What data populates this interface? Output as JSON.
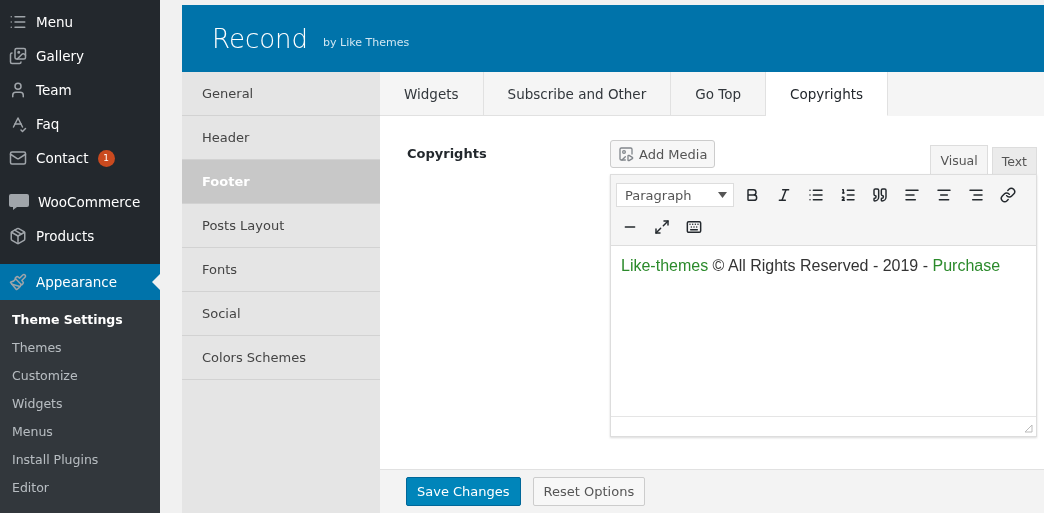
{
  "sidebar": {
    "items": [
      {
        "label": "Menu",
        "selected": false
      },
      {
        "label": "Gallery",
        "selected": false
      },
      {
        "label": "Team",
        "selected": false
      },
      {
        "label": "Faq",
        "selected": false
      },
      {
        "label": "Contact",
        "selected": false,
        "badge": "1"
      },
      {
        "label": "WooCommerce",
        "selected": false
      },
      {
        "label": "Products",
        "selected": false
      },
      {
        "label": "Appearance",
        "selected": true
      }
    ],
    "submenu": [
      {
        "label": "Theme Settings",
        "selected": true
      },
      {
        "label": "Themes",
        "selected": false
      },
      {
        "label": "Customize",
        "selected": false
      },
      {
        "label": "Widgets",
        "selected": false
      },
      {
        "label": "Menus",
        "selected": false
      },
      {
        "label": "Install Plugins",
        "selected": false
      },
      {
        "label": "Editor",
        "selected": false
      }
    ]
  },
  "header": {
    "title": "Recond",
    "subtitle": "by Like Themes"
  },
  "sections": [
    {
      "label": "General",
      "selected": false
    },
    {
      "label": "Header",
      "selected": false
    },
    {
      "label": "Footer",
      "selected": true
    },
    {
      "label": "Posts Layout",
      "selected": false
    },
    {
      "label": "Fonts",
      "selected": false
    },
    {
      "label": "Social",
      "selected": false
    },
    {
      "label": "Colors Schemes",
      "selected": false
    }
  ],
  "tabs": [
    {
      "label": "Widgets",
      "selected": false
    },
    {
      "label": "Subscribe and Other",
      "selected": false
    },
    {
      "label": "Go Top",
      "selected": false
    },
    {
      "label": "Copyrights",
      "selected": true
    }
  ],
  "field": {
    "label": "Copyrights",
    "add_media": "Add Media",
    "modes": [
      {
        "label": "Visual",
        "selected": true
      },
      {
        "label": "Text",
        "selected": false
      }
    ],
    "format": "Paragraph",
    "content": [
      {
        "text": "Like-themes",
        "kind": "link"
      },
      {
        "text": " © All Rights Reserved - 2019 - ",
        "kind": "plain"
      },
      {
        "text": "Purchase",
        "kind": "link"
      }
    ]
  },
  "buttons": [
    {
      "label": "Save Changes",
      "kind": "primary"
    },
    {
      "label": "Reset Options",
      "kind": "secondary"
    }
  ]
}
